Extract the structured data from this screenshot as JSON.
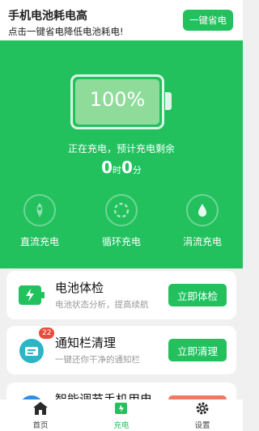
{
  "banner": {
    "title": "手机电池耗电高",
    "subtitle": "点击一键省电降低电池耗电!",
    "button": "一键省电"
  },
  "battery": {
    "level_text": "100%",
    "level": 1.0
  },
  "charging": {
    "status": "正在充电，预计充电剩余",
    "hours": "0",
    "hours_unit": "时",
    "minutes": "0",
    "minutes_unit": "分"
  },
  "modes": [
    {
      "label": "直流充电",
      "icon": "rocket-icon"
    },
    {
      "label": "循环充电",
      "icon": "cycle-icon"
    },
    {
      "label": "涓流充电",
      "icon": "drop-icon"
    }
  ],
  "cards": [
    {
      "title": "电池体检",
      "subtitle": "电池状态分析，提高续航",
      "button": "立即体检",
      "icon": "battery-check-icon"
    },
    {
      "title": "通知栏清理",
      "subtitle": "一键还你干净的通知栏",
      "button": "立即清理",
      "icon": "notification-icon",
      "badge": "22"
    },
    {
      "title": "智能调节手机用电",
      "icon": "smart-power-icon"
    }
  ],
  "bottom_nav": [
    {
      "label": "首页",
      "icon": "home-icon"
    },
    {
      "label": "充电",
      "icon": "charging-icon",
      "active": true
    },
    {
      "label": "设置",
      "icon": "gear-icon"
    }
  ],
  "colors": {
    "accent": "#22c15e",
    "badge": "#e74c3c"
  }
}
